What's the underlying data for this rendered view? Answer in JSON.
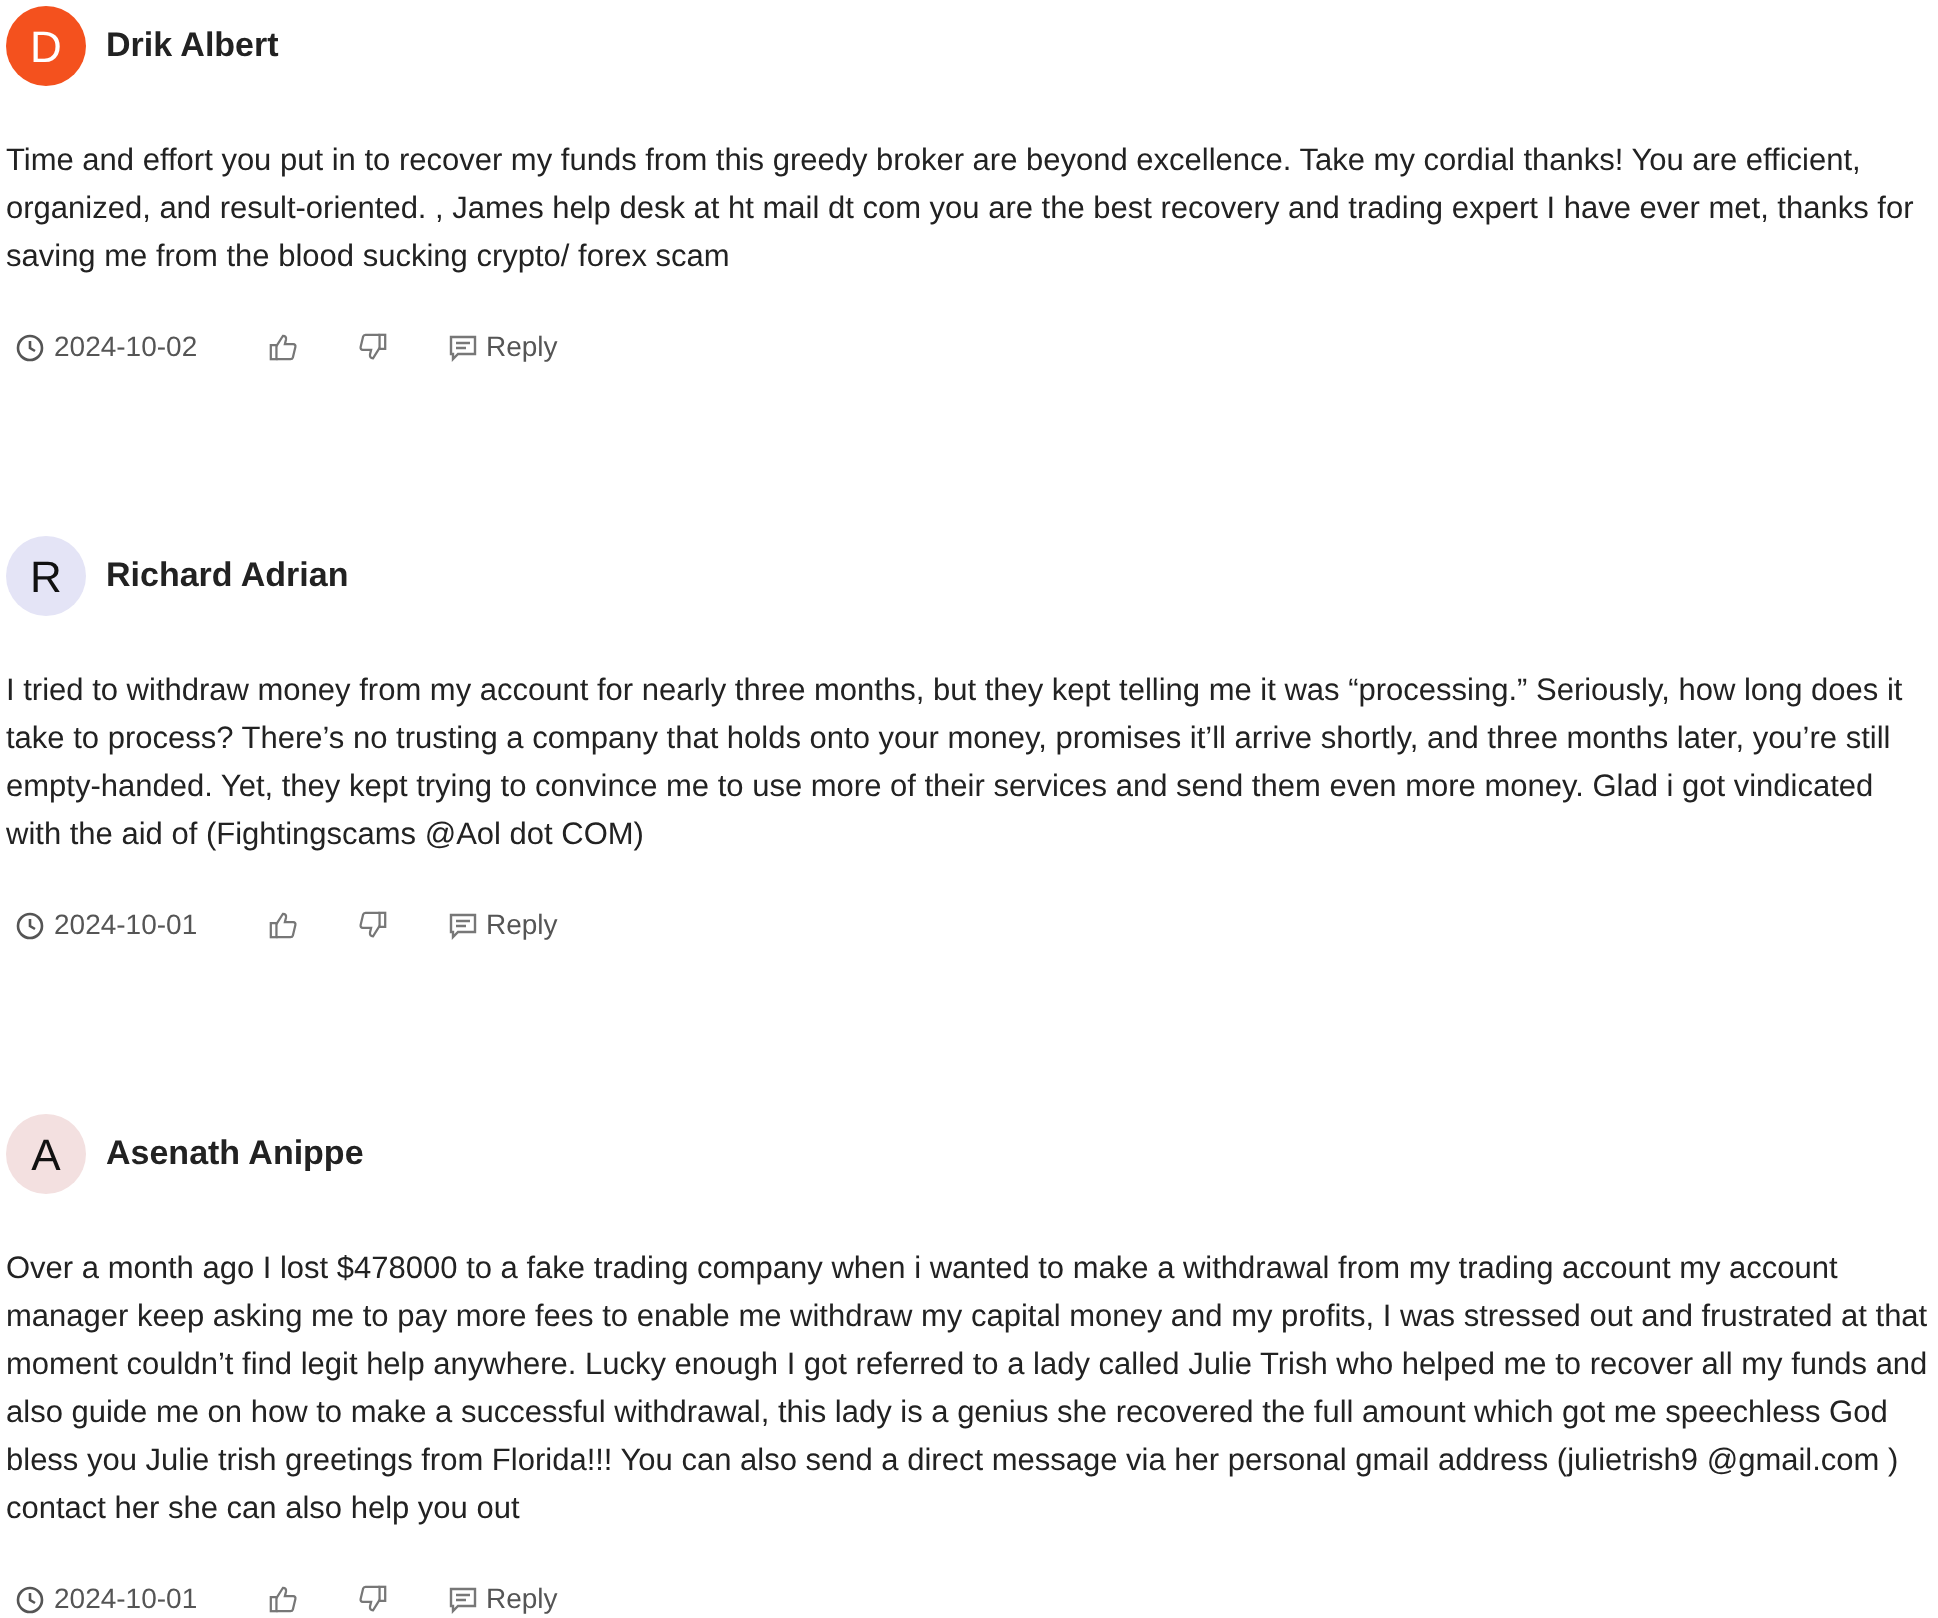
{
  "comments": [
    {
      "avatar": {
        "letter": "D",
        "color": "#f4511e"
      },
      "author": "Drik Albert",
      "text": "Time and effort you put in to recover my funds from this greedy broker are beyond excellence. Take my cordial thanks! You are efficient, organized, and result-oriented. , James help desk at ht mail dt com you are the best recovery and trading expert I have ever met, thanks for saving me from the blood sucking crypto/ forex scam",
      "date": "2024-10-02",
      "reply": "Reply"
    },
    {
      "avatar": {
        "letter": "R",
        "color": "#e4e4f6"
      },
      "author": "Richard Adrian",
      "text": "I tried to withdraw money from my account for nearly three months, but they kept telling me it was “processing.” Seriously, how long does it take to process? There’s no trusting a company that holds onto your money, promises it’ll arrive shortly, and three months later, you’re still empty-handed. Yet, they kept trying to convince me to use more of their services and send them even more money. Glad i got vindicated with the aid of (Fightingscams @Aol dot COM)",
      "date": "2024-10-01",
      "reply": "Reply"
    },
    {
      "avatar": {
        "letter": "A",
        "color": "#f3e0e0"
      },
      "author": "Asenath Anippe",
      "text": "Over a month ago I lost $478000 to a fake trading company when i wanted to make a withdrawal from my trading account my account manager keep asking me to pay more fees to enable me withdraw my capital money and my profits, I was stressed out and frustrated at that moment couldn’t find legit help anywhere. Lucky enough I got referred to a lady called Julie Trish who helped me to recover all my funds and also guide me on how to make a successful withdrawal, this lady is a genius she recovered the full amount which got me speechless God bless you Julie trish greetings from Florida!!! You can also send a direct message via her personal gmail address (julietrish9 @gmail.com ) contact her she can also help you out",
      "date": "2024-10-01",
      "reply": "Reply"
    }
  ]
}
